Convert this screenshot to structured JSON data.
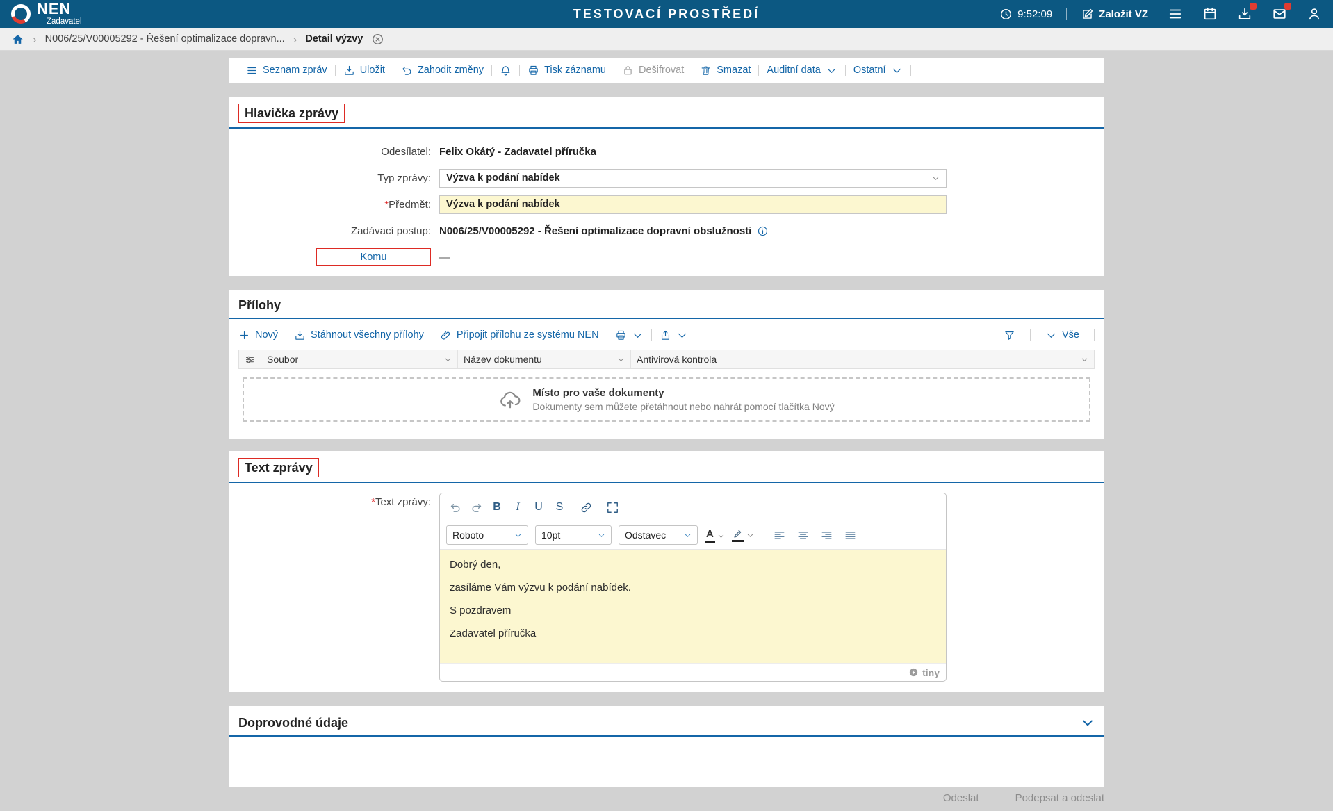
{
  "colors": {
    "header_bg": "#0c5882",
    "link_blue": "#1466a8",
    "highlight_yellow": "#fcf7d0",
    "validation_red": "#dd2b24"
  },
  "glyphs": {
    "separator": "›"
  },
  "header": {
    "brand": "NEN",
    "brand_sub": "Zadavatel",
    "env_title": "TESTOVACÍ PROSTŘEDÍ",
    "time": "9:52:09",
    "create_vz": "Založit VZ"
  },
  "breadcrumb": {
    "item1": "N006/25/V00005292 - Řešení optimalizace dopravn...",
    "item2": "Detail výzvy"
  },
  "toolbar": {
    "seznam": "Seznam zpráv",
    "ulozit": "Uložit",
    "zahodit": "Zahodit změny",
    "tisk": "Tisk záznamu",
    "desifrovat": "Dešifrovat",
    "smazat": "Smazat",
    "auditni": "Auditní data",
    "ostatni": "Ostatní"
  },
  "hlavicka": {
    "title": "Hlavička zprávy",
    "odesilatel_label": "Odesílatel:",
    "odesilatel_value": "Felix Okátý - Zadavatel příručka",
    "typ_label": "Typ zprávy:",
    "typ_value": "Výzva k podání nabídek",
    "predmet_required": "*",
    "predmet_label": "Předmět:",
    "predmet_value": "Výzva k podání nabídek",
    "postup_label": "Zadávací postup:",
    "postup_value": "N006/25/V00005292 - Řešení optimalizace dopravní obslužnosti",
    "komu_label": "Komu",
    "komu_value": "—"
  },
  "prilohy": {
    "title": "Přílohy",
    "novy": "Nový",
    "stahnout": "Stáhnout všechny přílohy",
    "pripojit": "Připojit přílohu ze systému NEN",
    "vse": "Vše",
    "col_soubor": "Soubor",
    "col_nazev": "Název dokumentu",
    "col_antivir": "Antivirová kontrola",
    "empty_title": "Místo pro vaše dokumenty",
    "empty_text": "Dokumenty sem můžete přetáhnout nebo nahrát pomocí tlačítka Nový"
  },
  "text_zpravy": {
    "title": "Text zprávy",
    "required": "*",
    "label": "Text zprávy:",
    "font": "Roboto",
    "size": "10pt",
    "format": "Odstavec",
    "bold": "B",
    "italic": "I",
    "underline": "U",
    "strike": "S",
    "textcolor": "A",
    "p1": "Dobrý den,",
    "p2": "zasíláme Vám výzvu k podání nabídek.",
    "p3": "S pozdravem",
    "p4": "Zadavatel příručka",
    "brand": "tiny"
  },
  "doprovodne": {
    "title": "Doprovodné údaje"
  },
  "footer": {
    "odeslat": "Odeslat",
    "podepsat": "Podepsat a odeslat"
  }
}
